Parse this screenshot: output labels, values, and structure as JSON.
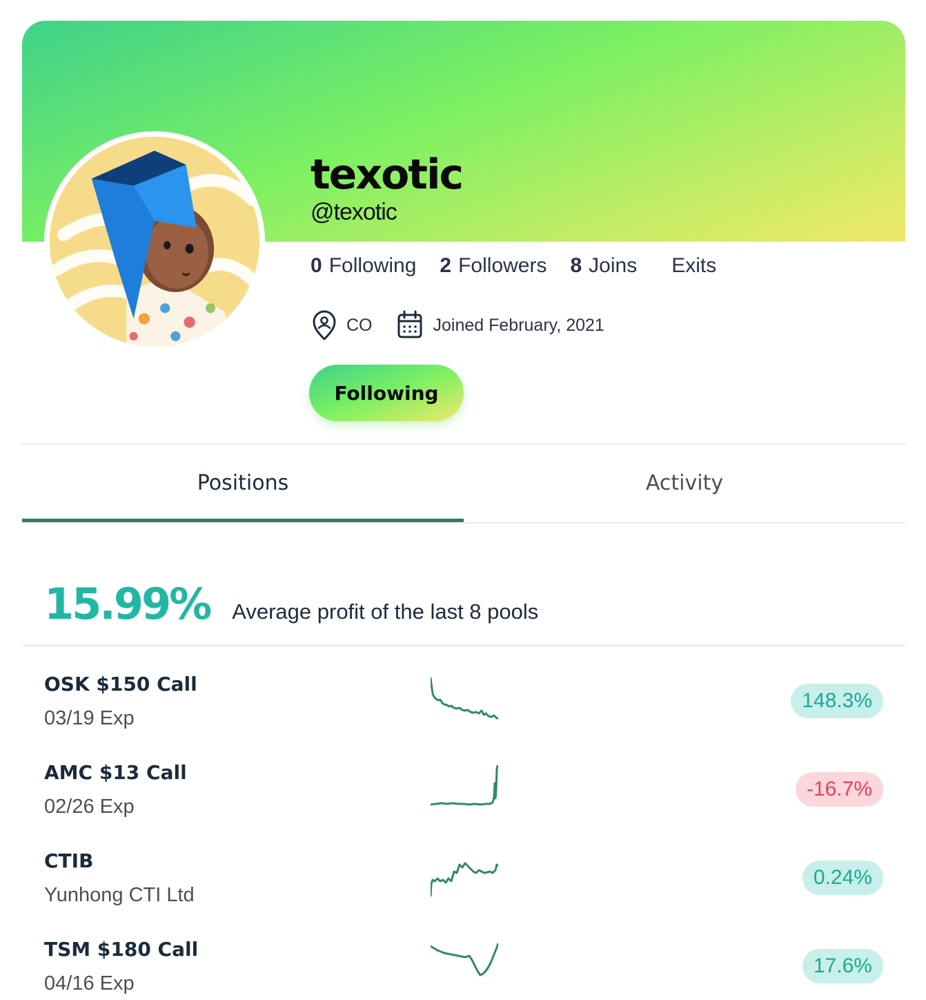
{
  "profile": {
    "display_name": "texotic",
    "handle": "@texotic",
    "stats": [
      {
        "count": "0",
        "label": "Following"
      },
      {
        "count": "2",
        "label": "Followers"
      },
      {
        "count": "8",
        "label": "Joins"
      },
      {
        "count": "",
        "label": "Exits"
      }
    ],
    "location": "CO",
    "joined": "Joined February, 2021",
    "follow_button_label": "Following"
  },
  "tabs": [
    {
      "label": "Positions",
      "active": true
    },
    {
      "label": "Activity",
      "active": false
    }
  ],
  "summary": {
    "average_profit": "15.99%",
    "average_label": "Average profit of the last 8 pools"
  },
  "positions": [
    {
      "title": "OSK $150 Call",
      "subtitle": "03/19 Exp",
      "change": "148.3%",
      "status": "positive"
    },
    {
      "title": "AMC $13 Call",
      "subtitle": "02/26 Exp",
      "change": "-16.7%",
      "status": "negative"
    },
    {
      "title": "CTIB",
      "subtitle": "Yunhong CTI Ltd",
      "change": "0.24%",
      "status": "positive"
    },
    {
      "title": "TSM $180 Call",
      "subtitle": "04/16 Exp",
      "change": "17.6%",
      "status": "positive"
    }
  ],
  "colors": {
    "brand_gradient": [
      "#3fd28a",
      "#7cf062",
      "#f2e86a"
    ],
    "accent_teal": "#22b7a3",
    "tab_underline": "#2f7d63",
    "positive_badge_bg": "#c8efe9",
    "negative_badge_bg": "#fbd7dc",
    "sparkline": "#2f8a66"
  },
  "icons": {
    "location": "map-pin-user-icon",
    "joined": "calendar-icon"
  }
}
